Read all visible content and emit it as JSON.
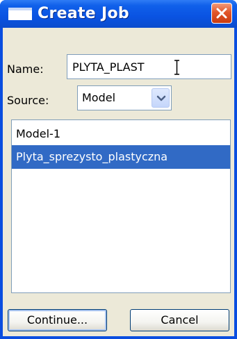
{
  "window": {
    "title": "Create Job",
    "icons": {
      "title_icon": "window-icon",
      "close": "close-x-icon"
    }
  },
  "form": {
    "name_label": "Name:",
    "name_value": "PLYTA_PLAST",
    "source_label": "Source:",
    "source_value": "Model",
    "source_icon": "chevron-down-icon"
  },
  "list": {
    "items": [
      {
        "label": "Model-1",
        "selected": false
      },
      {
        "label": "Plyta_sprezysto_plastyczna",
        "selected": true
      }
    ]
  },
  "buttons": {
    "continue_label": "Continue...",
    "cancel_label": "Cancel"
  },
  "colors": {
    "titlebar": "#0a53e2",
    "close_button": "#e2562a",
    "selection": "#316ac5",
    "dialog_face": "#ece9d8"
  }
}
